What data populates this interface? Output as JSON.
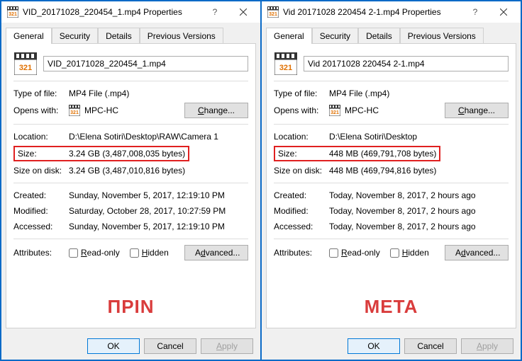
{
  "left": {
    "title": "VID_20171028_220454_1.mp4 Properties",
    "tabs": [
      "General",
      "Security",
      "Details",
      "Previous Versions"
    ],
    "filename": "VID_20171028_220454_1.mp4",
    "type_label": "Type of file:",
    "type_value": "MP4 File (.mp4)",
    "opens_label": "Opens with:",
    "opens_value": "MPC-HC",
    "change_btn": "Change...",
    "location_label": "Location:",
    "location_value": "D:\\Elena Sotiri\\Desktop\\RAW\\Camera 1",
    "size_label": "Size:",
    "size_value": "3.24 GB (3,487,008,035 bytes)",
    "disk_label": "Size on disk:",
    "disk_value": "3.24 GB (3,487,010,816 bytes)",
    "created_label": "Created:",
    "created_value": "Sunday, November 5, 2017, 12:19:10 PM",
    "modified_label": "Modified:",
    "modified_value": "Saturday, October 28, 2017, 10:27:59 PM",
    "accessed_label": "Accessed:",
    "accessed_value": "Sunday, November 5, 2017, 12:19:10 PM",
    "attr_label": "Attributes:",
    "readonly_label": "Read-only",
    "hidden_label": "Hidden",
    "advanced_btn": "Advanced...",
    "overlay_text": "ΠΡΙΝ",
    "ok": "OK",
    "cancel": "Cancel",
    "apply": "Apply"
  },
  "right": {
    "title": "Vid 20171028 220454 2-1.mp4 Properties",
    "tabs": [
      "General",
      "Security",
      "Details",
      "Previous Versions"
    ],
    "filename": "Vid 20171028 220454 2-1.mp4",
    "type_label": "Type of file:",
    "type_value": "MP4 File (.mp4)",
    "opens_label": "Opens with:",
    "opens_value": "MPC-HC",
    "change_btn": "Change...",
    "location_label": "Location:",
    "location_value": "D:\\Elena Sotiri\\Desktop",
    "size_label": "Size:",
    "size_value": "448 MB (469,791,708 bytes)",
    "disk_label": "Size on disk:",
    "disk_value": "448 MB (469,794,816 bytes)",
    "created_label": "Created:",
    "created_value": "Today, November 8, 2017, 2 hours ago",
    "modified_label": "Modified:",
    "modified_value": "Today, November 8, 2017, 2 hours ago",
    "accessed_label": "Accessed:",
    "accessed_value": "Today, November 8, 2017, 2 hours ago",
    "attr_label": "Attributes:",
    "readonly_label": "Read-only",
    "hidden_label": "Hidden",
    "advanced_btn": "Advanced...",
    "overlay_text": "META",
    "ok": "OK",
    "cancel": "Cancel",
    "apply": "Apply"
  }
}
